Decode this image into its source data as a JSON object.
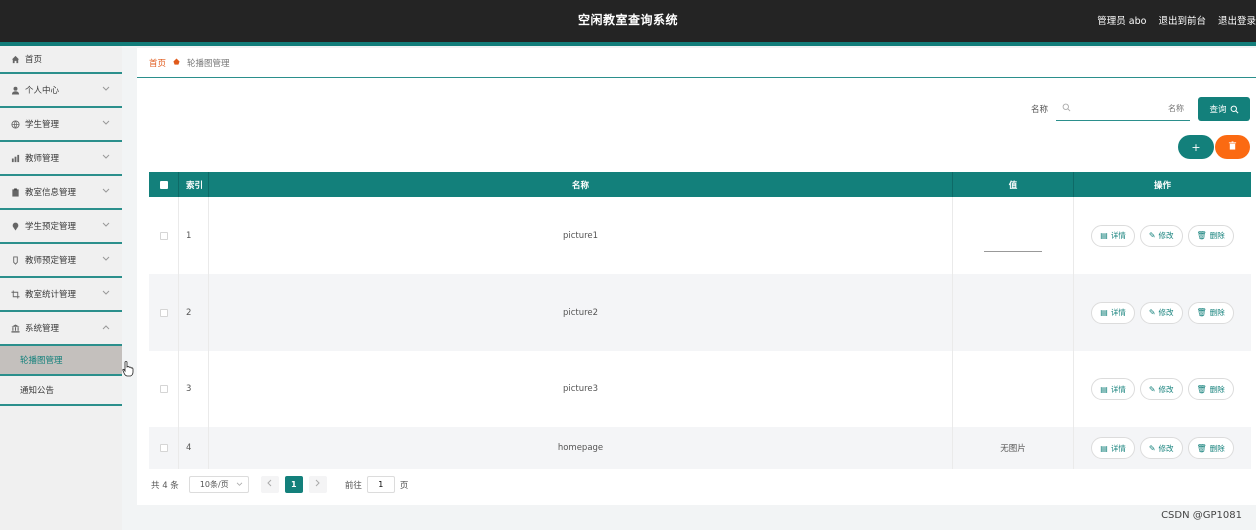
{
  "header": {
    "title": "空闲教室查询系统",
    "admin_label": "管理员 abo",
    "to_front": "退出到前台",
    "logout": "退出登录"
  },
  "sidebar": {
    "items": [
      {
        "label": "首页",
        "icon": "home-icon"
      },
      {
        "label": "个人中心",
        "icon": "user-icon"
      },
      {
        "label": "学生管理",
        "icon": "globe-icon"
      },
      {
        "label": "教师管理",
        "icon": "chart-icon"
      },
      {
        "label": "教室信息管理",
        "icon": "clipboard-icon"
      },
      {
        "label": "学生预定管理",
        "icon": "pin-icon"
      },
      {
        "label": "教师预定管理",
        "icon": "badge-icon"
      },
      {
        "label": "教室统计管理",
        "icon": "crop-icon"
      },
      {
        "label": "系统管理",
        "icon": "bank-icon"
      }
    ],
    "sub_items": [
      {
        "label": "轮播图管理",
        "active": true
      },
      {
        "label": "通知公告",
        "active": false
      }
    ]
  },
  "breadcrumb": {
    "home": "首页",
    "current": "轮播图管理"
  },
  "search": {
    "label": "名称",
    "placeholder": "名称",
    "button": "查询"
  },
  "toolbar": {
    "add": "+",
    "delete": "🗑"
  },
  "table": {
    "headers": {
      "index": "索引",
      "name": "名称",
      "value": "值",
      "ops": "操作"
    },
    "rows": [
      {
        "index": "1",
        "name": "picture1",
        "value": ""
      },
      {
        "index": "2",
        "name": "picture2",
        "value": ""
      },
      {
        "index": "3",
        "name": "picture3",
        "value": ""
      },
      {
        "index": "4",
        "name": "homepage",
        "value": "无图片"
      }
    ],
    "op_labels": {
      "detail": "详情",
      "edit": "修改",
      "delete": "删除"
    }
  },
  "pagination": {
    "total": "共 4 条",
    "page_size": "10条/页",
    "current_page": "1",
    "goto_label": "前往",
    "goto_value": "1",
    "page_suffix": "页"
  },
  "watermark": "CSDN @GP1081",
  "colors": {
    "accent": "#13807b",
    "danger": "#fb6a12",
    "topbar": "#242424",
    "breadcrumb_home": "#e05a1b"
  }
}
